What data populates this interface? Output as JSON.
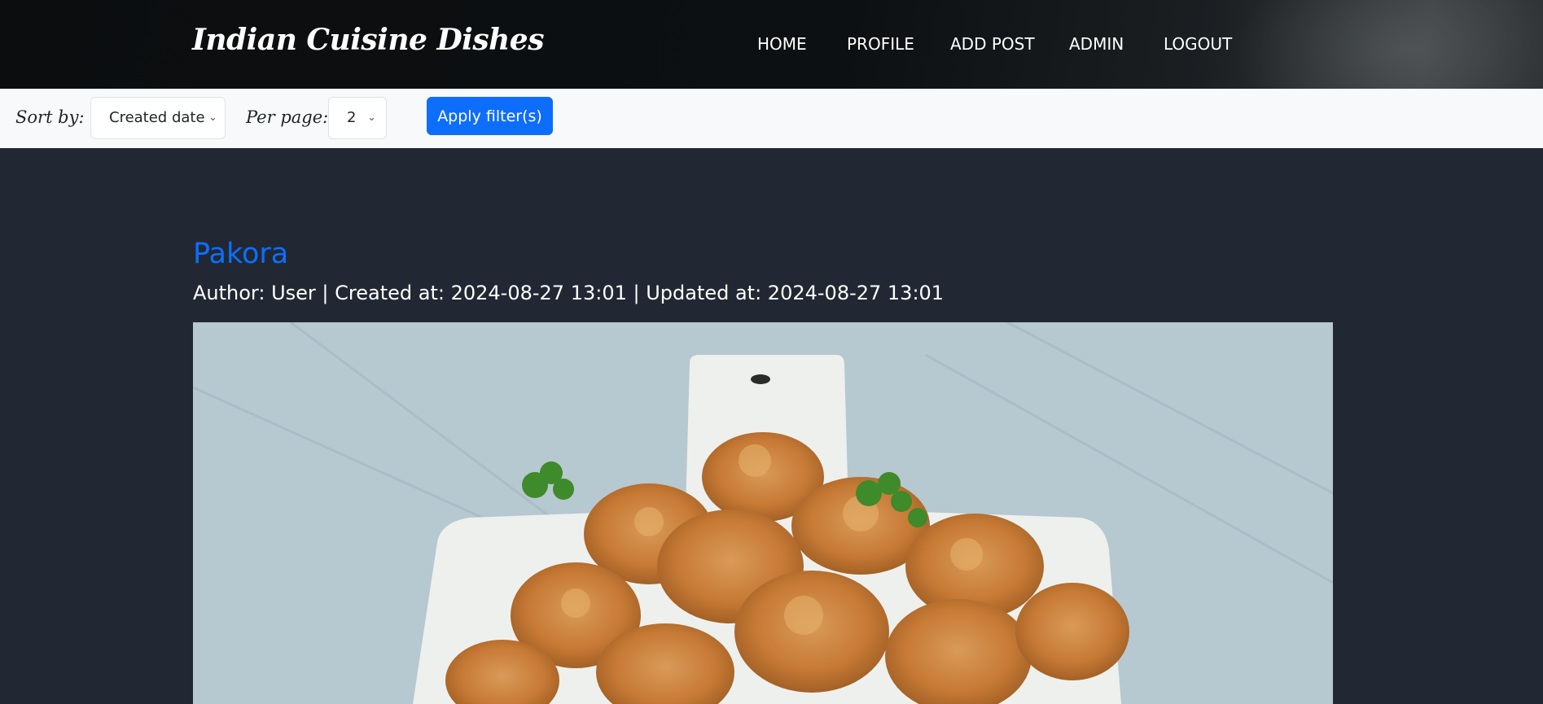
{
  "header": {
    "brand": "Indian Cuisine Dishes",
    "nav": [
      "HOME",
      "PROFILE",
      "ADD POST",
      "ADMIN",
      "LOGOUT"
    ]
  },
  "filters": {
    "sort_label": "Sort by:",
    "sort_value": "Created date",
    "per_page_label": "Per page:",
    "per_page_value": "2",
    "apply_label": "Apply filter(s)"
  },
  "post": {
    "title": "Pakora",
    "meta": "Author: User | Created at: 2024-08-27 13:01 | Updated at: 2024-08-27 13:01",
    "image_subject": "pakora-photo"
  },
  "colors": {
    "accent": "#0d6efd",
    "page_bg": "#212833",
    "filterbar_bg": "#f8f9fa"
  }
}
